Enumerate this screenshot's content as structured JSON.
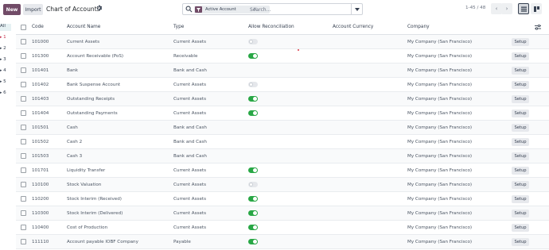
{
  "toolbar": {
    "new_label": "New",
    "import_label": "Import",
    "title": "Chart of Accounts"
  },
  "search": {
    "facet_label": "Active Account",
    "placeholder": "Search..."
  },
  "pager": {
    "text": "1-45 / 48"
  },
  "side_panel": {
    "items": [
      "All",
      "1",
      "2",
      "3",
      "4",
      "5",
      "6"
    ]
  },
  "table": {
    "headers": {
      "code": "Code",
      "name": "Account Name",
      "type": "Type",
      "reconcile": "Allow Reconciliation",
      "currency": "Account Currency",
      "company": "Company"
    },
    "setup_label": "Setup",
    "rows": [
      {
        "code": "101000",
        "name": "Current Assets",
        "type": "Current Assets",
        "reconcile": "off",
        "company": "My Company (San Francisco)"
      },
      {
        "code": "101300",
        "name": "Account Receivable (PoS)",
        "type": "Receivable",
        "reconcile": "on",
        "company": "My Company (San Francisco)"
      },
      {
        "code": "101401",
        "name": "Bank",
        "type": "Bank and Cash",
        "reconcile": "none",
        "company": "My Company (San Francisco)"
      },
      {
        "code": "101402",
        "name": "Bank Suspense Account",
        "type": "Current Assets",
        "reconcile": "off",
        "company": "My Company (San Francisco)"
      },
      {
        "code": "101403",
        "name": "Outstanding Receipts",
        "type": "Current Assets",
        "reconcile": "on",
        "company": "My Company (San Francisco)"
      },
      {
        "code": "101404",
        "name": "Outstanding Payments",
        "type": "Current Assets",
        "reconcile": "on",
        "company": "My Company (San Francisco)"
      },
      {
        "code": "101501",
        "name": "Cash",
        "type": "Bank and Cash",
        "reconcile": "none",
        "company": "My Company (San Francisco)"
      },
      {
        "code": "101502",
        "name": "Cash 2",
        "type": "Bank and Cash",
        "reconcile": "none",
        "company": "My Company (San Francisco)"
      },
      {
        "code": "101503",
        "name": "Cash 3",
        "type": "Bank and Cash",
        "reconcile": "none",
        "company": "My Company (San Francisco)"
      },
      {
        "code": "101701",
        "name": "Liquidity Transfer",
        "type": "Current Assets",
        "reconcile": "on",
        "company": "My Company (San Francisco)"
      },
      {
        "code": "110100",
        "name": "Stock Valuation",
        "type": "Current Assets",
        "reconcile": "off",
        "company": "My Company (San Francisco)"
      },
      {
        "code": "110200",
        "name": "Stock Interim (Received)",
        "type": "Current Assets",
        "reconcile": "on",
        "company": "My Company (San Francisco)"
      },
      {
        "code": "110300",
        "name": "Stock Interim (Delivered)",
        "type": "Current Assets",
        "reconcile": "on",
        "company": "My Company (San Francisco)"
      },
      {
        "code": "110400",
        "name": "Cost of Production",
        "type": "Current Assets",
        "reconcile": "on",
        "company": "My Company (San Francisco)"
      },
      {
        "code": "111110",
        "name": "Account payable IOBF Company",
        "type": "Payable",
        "reconcile": "on",
        "company": "My Company (San Francisco)"
      }
    ]
  },
  "colors": {
    "brand": "#714b67",
    "toggle_on": "#28a745",
    "toggle_off": "#e5e7eb"
  }
}
